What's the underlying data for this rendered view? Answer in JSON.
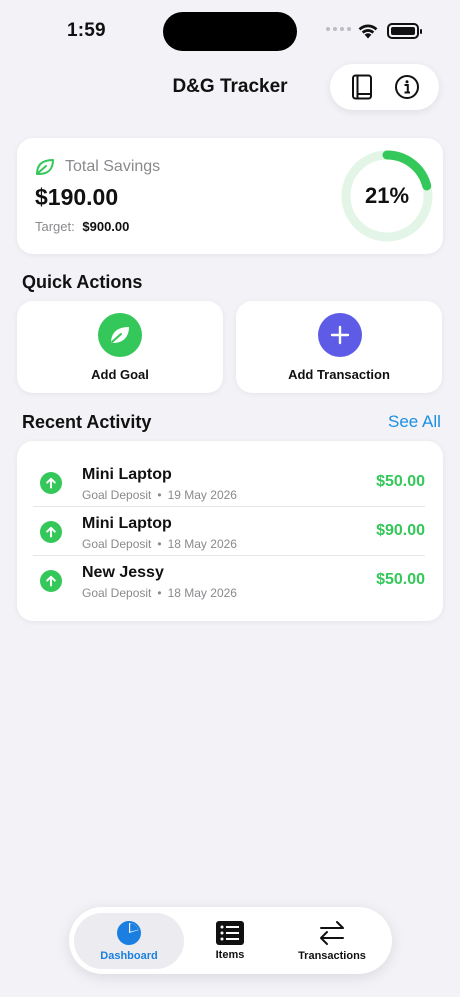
{
  "status_bar": {
    "time": "1:59"
  },
  "header": {
    "title": "D&G Tracker"
  },
  "savings": {
    "label": "Total Savings",
    "amount": "$190.00",
    "target_label": "Target:",
    "target_value": "$900.00",
    "progress_text": "21%",
    "progress_fraction": 0.21
  },
  "quick_actions": {
    "title": "Quick Actions",
    "items": [
      {
        "label": "Add Goal",
        "icon": "leaf-icon",
        "color": "#34C759"
      },
      {
        "label": "Add Transaction",
        "icon": "plus-icon",
        "color": "#5E5CE6"
      }
    ]
  },
  "recent_activity": {
    "title": "Recent Activity",
    "see_all": "See All",
    "items": [
      {
        "title": "Mini Laptop",
        "type": "Goal Deposit",
        "date": "19 May 2026",
        "amount": "$50.00"
      },
      {
        "title": "Mini Laptop",
        "type": "Goal Deposit",
        "date": "18 May 2026",
        "amount": "$90.00"
      },
      {
        "title": "New Jessy",
        "type": "Goal Deposit",
        "date": "18 May 2026",
        "amount": "$50.00"
      }
    ],
    "separator": "•"
  },
  "tabs": [
    {
      "label": "Dashboard",
      "icon": "pie-chart-icon",
      "active": true
    },
    {
      "label": "Items",
      "icon": "list-icon",
      "active": false
    },
    {
      "label": "Transactions",
      "icon": "arrows-swap-icon",
      "active": false
    }
  ],
  "colors": {
    "accent_green": "#34C759",
    "accent_blue": "#1a7fe0",
    "accent_purple": "#5E5CE6",
    "background": "#F2F2F7"
  }
}
